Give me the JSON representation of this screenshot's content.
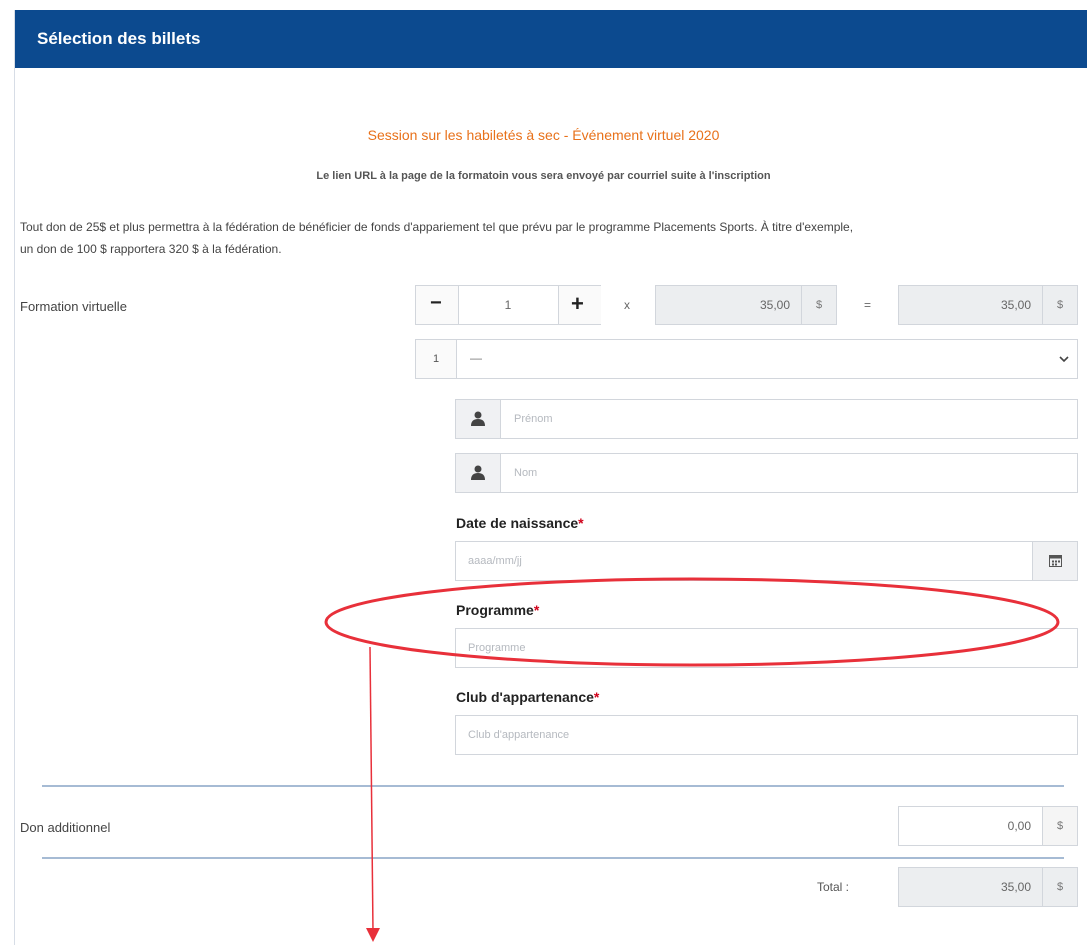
{
  "header": {
    "title": "Sélection des billets"
  },
  "event": {
    "title": "Session sur les habiletés à sec - Événement virtuel 2020",
    "subtitle": "Le lien URL à la page de la formatoin vous sera envoyé par courriel suite à l'inscription",
    "title_color": "#e8711a"
  },
  "notice": {
    "line1": "Tout don de 25$ et plus permettra à la fédération de bénéficier de fonds d'appariement tel que prévu par le programme Placements Sports. À titre d'exemple,",
    "line2": "un don de 100 $ rapportera 320 $ à la fédération."
  },
  "ticket": {
    "label": "Formation virtuelle",
    "minus": "−",
    "quantity": "1",
    "plus": "+",
    "times": "x",
    "unit_price": "35,00",
    "currency": "$",
    "equals": "=",
    "line_total": "35,00"
  },
  "attendee": {
    "index": "1",
    "select_value": "—",
    "firstname_placeholder": "Prénom",
    "lastname_placeholder": "Nom",
    "dob_label": "Date de naissance",
    "dob_placeholder": "aaaa/mm/jj",
    "program_label": "Programme",
    "program_placeholder": "Programme",
    "club_label": "Club d'appartenance",
    "club_placeholder": "Club d'appartenance",
    "required_mark": "*"
  },
  "donation": {
    "label": "Don additionnel",
    "value": "0,00",
    "currency": "$"
  },
  "total": {
    "label": "Total :",
    "value": "35,00",
    "currency": "$"
  },
  "annotation": {
    "color": "#e8303a"
  }
}
